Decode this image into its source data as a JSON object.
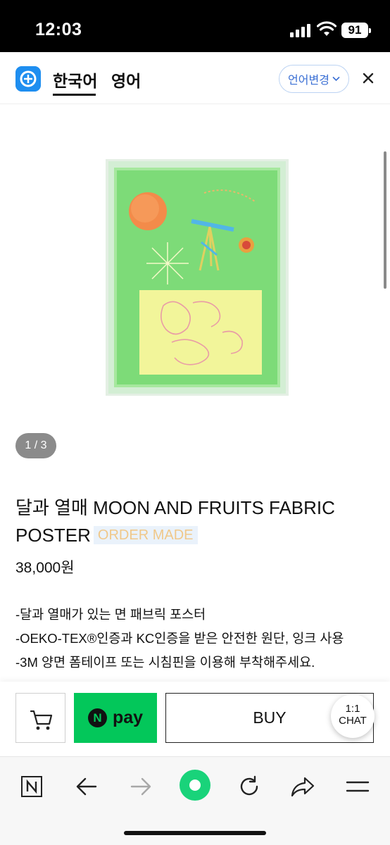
{
  "status_bar": {
    "time": "12:03",
    "battery": "91"
  },
  "lang_header": {
    "tab_korean": "한국어",
    "tab_english": "영어",
    "change_language_label": "언어변경"
  },
  "product": {
    "image_counter": "1 / 3",
    "title": "달과 열매 MOON AND FRUITS FABRIC POSTER",
    "badge": "ORDER MADE",
    "price": "38,000원",
    "description": [
      "-달과 열매가 있는 면 패브릭 포스터",
      "-OEKO-TEX®인증과 KC인증을 받은 안전한 원단, 잉크 사용",
      "-3M 양면 폼테이프 또는 시침핀을 이용해 부착해주세요."
    ]
  },
  "actions": {
    "npay_label": "pay",
    "npay_mark": "N",
    "buy_label": "BUY",
    "chat_line1": "1:1",
    "chat_line2": "CHAT"
  },
  "colors": {
    "npay_green": "#03c75a",
    "accent_blue": "#1e8ef0",
    "poster_green": "#7ddb78"
  }
}
